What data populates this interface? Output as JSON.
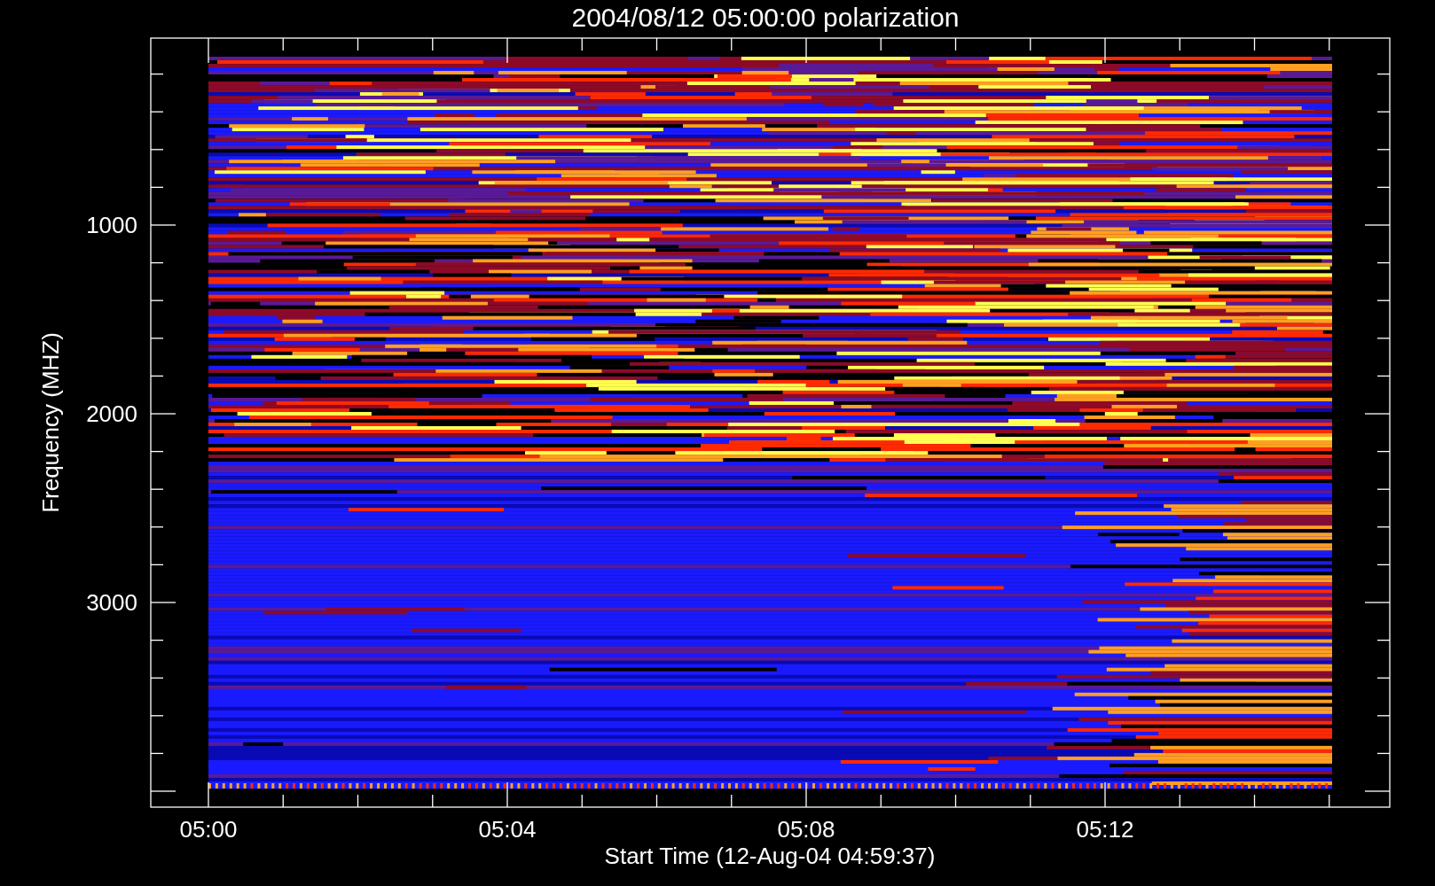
{
  "title": "2004/08/12 05:00:00 polarization",
  "y_axis": {
    "label": "Frequency (MHZ)",
    "tick_labels": [
      "1000",
      "2000",
      "3000"
    ]
  },
  "x_axis": {
    "label": "Start Time (12-Aug-04 04:59:37)",
    "tick_labels": [
      "05:00",
      "05:04",
      "05:08",
      "05:12"
    ]
  }
}
